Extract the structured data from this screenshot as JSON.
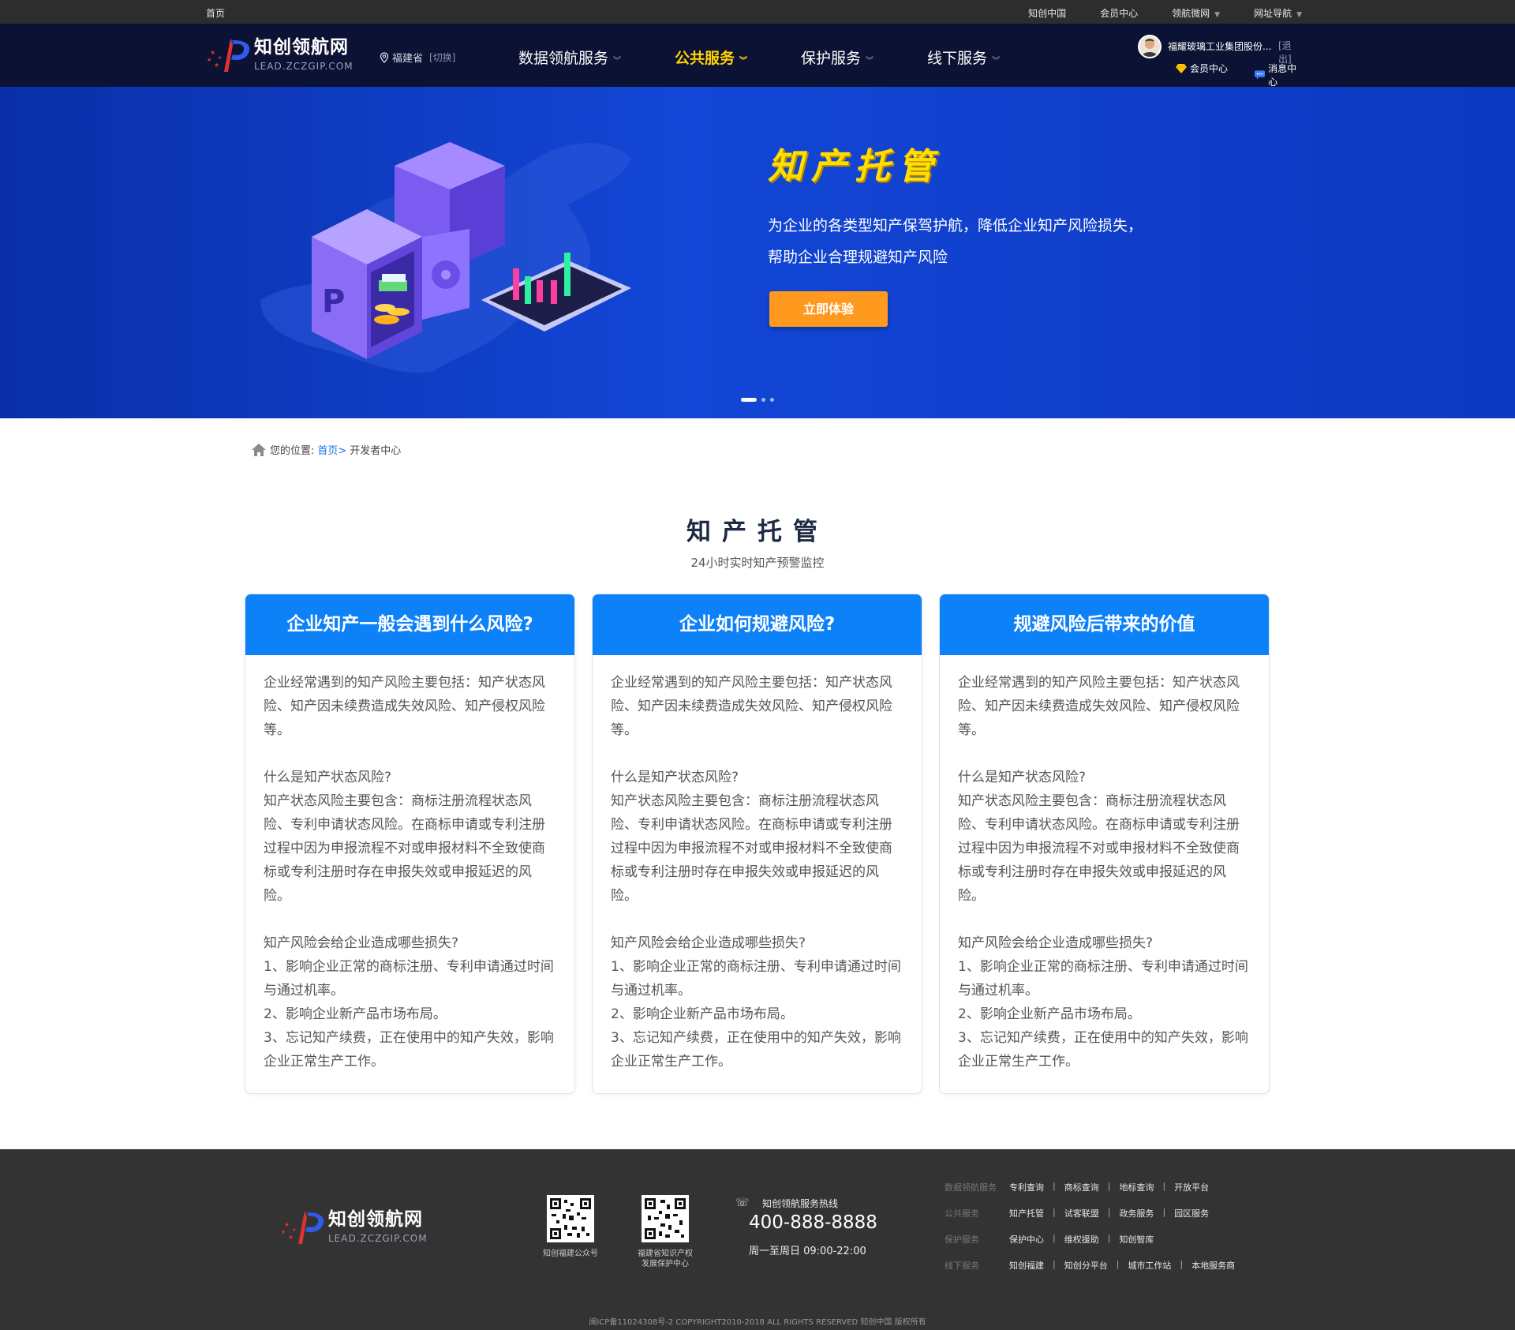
{
  "topbar": {
    "home": "首页",
    "links": [
      "知创中国",
      "会员中心",
      "领航微网",
      "网址导航"
    ]
  },
  "logo": {
    "main": "知创领航网",
    "sub": "LEAD.ZCZGIP.COM"
  },
  "region": {
    "name": "福建省",
    "switch": "[切换]"
  },
  "menu": [
    {
      "label": "数据领航服务",
      "active": false
    },
    {
      "label": "公共服务",
      "active": true
    },
    {
      "label": "保护服务",
      "active": false
    },
    {
      "label": "线下服务",
      "active": false
    }
  ],
  "user": {
    "name": "福耀玻璃工业集团股份...",
    "logout": "[退出]",
    "member_center": "会员中心",
    "message_center": "消息中心"
  },
  "banner": {
    "title": "知产托管",
    "desc_line1": "为企业的各类型知产保驾护航，降低企业知产风险损失，",
    "desc_line2": "帮助企业合理规避知产风险",
    "button": "立即体验",
    "slides": 3,
    "active_slide": 1
  },
  "breadcrumb": {
    "prefix": "您的位置:",
    "home": "首页>",
    "current": "开发者中心"
  },
  "section": {
    "title": "知产托管",
    "subtitle": "24小时实时知产预警监控"
  },
  "cards": [
    {
      "title": "企业知产一般会遇到什么风险?",
      "p1": "企业经常遇到的知产风险主要包括：知产状态风险、知产因未续费造成失效风险、知产侵权风险等。",
      "q1": "什么是知产状态风险?",
      "p2": "知产状态风险主要包含：商标注册流程状态风险、专利申请状态风险。在商标申请或专利注册过程中因为申报流程不对或申报材料不全致使商标或专利注册时存在申报失效或申报延迟的风险。",
      "q2": "知产风险会给企业造成哪些损失?",
      "l1": "1、影响企业正常的商标注册、专利申请通过时间与通过机率。",
      "l2": "2、影响企业新产品市场布局。",
      "l3": "3、忘记知产续费，正在使用中的知产失效，影响企业正常生产工作。"
    },
    {
      "title": "企业如何规避风险?",
      "p1": "企业经常遇到的知产风险主要包括：知产状态风险、知产因未续费造成失效风险、知产侵权风险等。",
      "q1": "什么是知产状态风险?",
      "p2": "知产状态风险主要包含：商标注册流程状态风险、专利申请状态风险。在商标申请或专利注册过程中因为申报流程不对或申报材料不全致使商标或专利注册时存在申报失效或申报延迟的风险。",
      "q2": "知产风险会给企业造成哪些损失?",
      "l1": "1、影响企业正常的商标注册、专利申请通过时间与通过机率。",
      "l2": "2、影响企业新产品市场布局。",
      "l3": "3、忘记知产续费，正在使用中的知产失效，影响企业正常生产工作。"
    },
    {
      "title": "规避风险后带来的价值",
      "p1": "企业经常遇到的知产风险主要包括：知产状态风险、知产因未续费造成失效风险、知产侵权风险等。",
      "q1": "什么是知产状态风险?",
      "p2": "知产状态风险主要包含：商标注册流程状态风险、专利申请状态风险。在商标申请或专利注册过程中因为申报流程不对或申报材料不全致使商标或专利注册时存在申报失效或申报延迟的风险。",
      "q2": "知产风险会给企业造成哪些损失?",
      "l1": "1、影响企业正常的商标注册、专利申请通过时间与通过机率。",
      "l2": "2、影响企业新产品市场布局。",
      "l3": "3、忘记知产续费，正在使用中的知产失效，影响企业正常生产工作。"
    }
  ],
  "footer": {
    "qr1_label": "知创福建公众号",
    "qr2_label_line1": "福建省知识产权",
    "qr2_label_line2": "发展保护中心",
    "hotline_label": "知创领航服务热线",
    "hotline": "400-888-8888",
    "hours": "周一至周日 09:00-22:00",
    "link_rows": [
      {
        "category": "数据领航服务",
        "items": [
          "专利查询",
          "商标查询",
          "地标查询",
          "开放平台"
        ]
      },
      {
        "category": "公共服务",
        "items": [
          "知产托管",
          "试客联盟",
          "政务服务",
          "园区服务"
        ]
      },
      {
        "category": "保护服务",
        "items": [
          "保护中心",
          "维权援助",
          "知创智库"
        ]
      },
      {
        "category": "线下服务",
        "items": [
          "知创福建",
          "知创分平台",
          "城市工作站",
          "本地服务商"
        ]
      }
    ],
    "copyright": "闽ICP备11024308号-2 COPYRIGHT2010-2018 ALL RIGHTS RESERVED 知创中国 版权所有"
  },
  "colors": {
    "accent_blue": "#0d81f8",
    "banner_yellow": "#ffde00",
    "button_orange": "#ff9a1f",
    "nav_bg": "#0b1233",
    "footer_bg": "#333333"
  }
}
